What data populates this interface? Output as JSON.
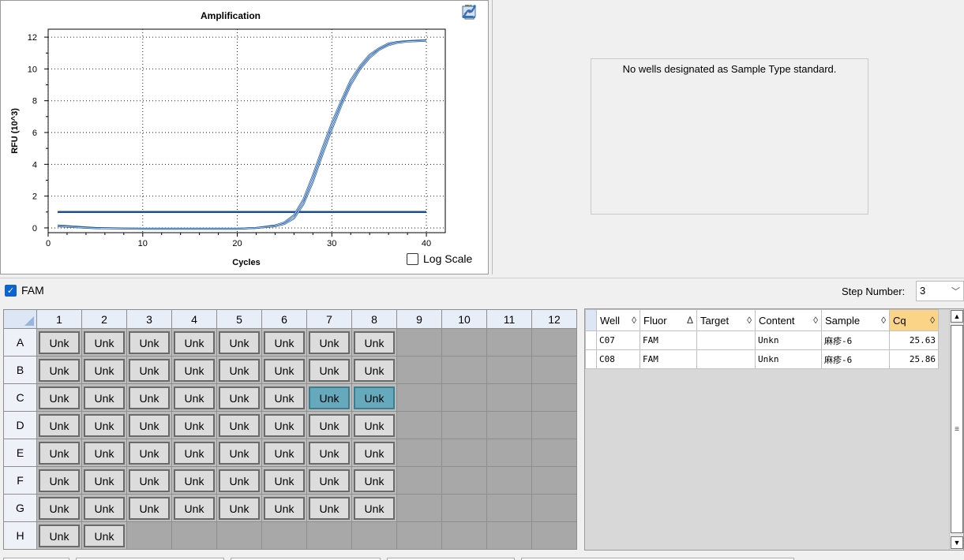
{
  "chart": {
    "title": "Amplification",
    "xlabel": "Cycles",
    "ylabel": "RFU (10^3)",
    "x_ticks": [
      "0",
      "10",
      "20",
      "30",
      "40"
    ],
    "y_ticks": [
      "0",
      "2",
      "4",
      "6",
      "8",
      "10",
      "12"
    ],
    "log_scale_label": "Log Scale",
    "toolbar_icons": [
      "copy-icon",
      "chart-type-icon",
      "export-icon",
      "settings-chart-icon",
      "curve-icon"
    ]
  },
  "chart_data": {
    "type": "line",
    "title": "Amplification",
    "xlabel": "Cycles",
    "ylabel": "RFU (10^3)",
    "xlim": [
      0,
      42
    ],
    "ylim": [
      -0.3,
      12.5
    ],
    "grid": true,
    "threshold": 1.0,
    "series": [
      {
        "x": [
          1,
          5,
          10,
          15,
          20,
          22,
          24,
          25,
          26,
          27,
          28,
          29,
          30,
          31,
          32,
          33,
          34,
          35,
          36,
          37,
          38,
          39,
          40
        ],
        "y": [
          0.15,
          0.0,
          -0.05,
          -0.05,
          -0.05,
          0.0,
          0.15,
          0.35,
          0.8,
          1.8,
          3.3,
          5.0,
          6.6,
          8.0,
          9.3,
          10.2,
          10.9,
          11.3,
          11.6,
          11.7,
          11.75,
          11.78,
          11.8
        ]
      },
      {
        "x": [
          1,
          5,
          10,
          15,
          20,
          22,
          24,
          25,
          26,
          27,
          28,
          29,
          30,
          31,
          32,
          33,
          34,
          35,
          36,
          37,
          38,
          39,
          40
        ],
        "y": [
          0.1,
          -0.02,
          -0.05,
          -0.05,
          -0.05,
          0.0,
          0.1,
          0.25,
          0.6,
          1.5,
          2.9,
          4.6,
          6.2,
          7.7,
          9.0,
          10.0,
          10.7,
          11.2,
          11.5,
          11.65,
          11.72,
          11.75,
          11.78
        ]
      }
    ]
  },
  "standard_panel": {
    "message": "No wells designated as Sample Type standard."
  },
  "fluor": {
    "label": "FAM",
    "checked": true
  },
  "step": {
    "label": "Step Number:",
    "value": "3"
  },
  "plate": {
    "columns": [
      "1",
      "2",
      "3",
      "4",
      "5",
      "6",
      "7",
      "8",
      "9",
      "10",
      "11",
      "12"
    ],
    "rows": [
      {
        "label": "A",
        "wells": [
          "Unk",
          "Unk",
          "Unk",
          "Unk",
          "Unk",
          "Unk",
          "Unk",
          "Unk",
          "",
          "",
          "",
          ""
        ]
      },
      {
        "label": "B",
        "wells": [
          "Unk",
          "Unk",
          "Unk",
          "Unk",
          "Unk",
          "Unk",
          "Unk",
          "Unk",
          "",
          "",
          "",
          ""
        ]
      },
      {
        "label": "C",
        "wells": [
          "Unk",
          "Unk",
          "Unk",
          "Unk",
          "Unk",
          "Unk",
          "Unk",
          "Unk",
          "",
          "",
          "",
          ""
        ],
        "selected": [
          6,
          7
        ]
      },
      {
        "label": "D",
        "wells": [
          "Unk",
          "Unk",
          "Unk",
          "Unk",
          "Unk",
          "Unk",
          "Unk",
          "Unk",
          "",
          "",
          "",
          ""
        ]
      },
      {
        "label": "E",
        "wells": [
          "Unk",
          "Unk",
          "Unk",
          "Unk",
          "Unk",
          "Unk",
          "Unk",
          "Unk",
          "",
          "",
          "",
          ""
        ]
      },
      {
        "label": "F",
        "wells": [
          "Unk",
          "Unk",
          "Unk",
          "Unk",
          "Unk",
          "Unk",
          "Unk",
          "Unk",
          "",
          "",
          "",
          ""
        ]
      },
      {
        "label": "G",
        "wells": [
          "Unk",
          "Unk",
          "Unk",
          "Unk",
          "Unk",
          "Unk",
          "Unk",
          "Unk",
          "",
          "",
          "",
          ""
        ]
      },
      {
        "label": "H",
        "wells": [
          "Unk",
          "Unk",
          "",
          "",
          "",
          "",
          "",
          "",
          "",
          "",
          "",
          ""
        ]
      }
    ]
  },
  "results": {
    "headers": [
      {
        "label": "Well",
        "sort": "◊"
      },
      {
        "label": "Fluor",
        "sort": "Δ"
      },
      {
        "label": "Target",
        "sort": "◊"
      },
      {
        "label": "Content",
        "sort": "◊"
      },
      {
        "label": "Sample",
        "sort": "◊"
      },
      {
        "label": "Cq",
        "sort": "◊"
      }
    ],
    "rows": [
      [
        "C07",
        "FAM",
        "",
        "Unkn",
        "麻疹-6",
        "25.63"
      ],
      [
        "C08",
        "FAM",
        "",
        "Unkn",
        "麻疹-6",
        "25.86"
      ]
    ]
  }
}
